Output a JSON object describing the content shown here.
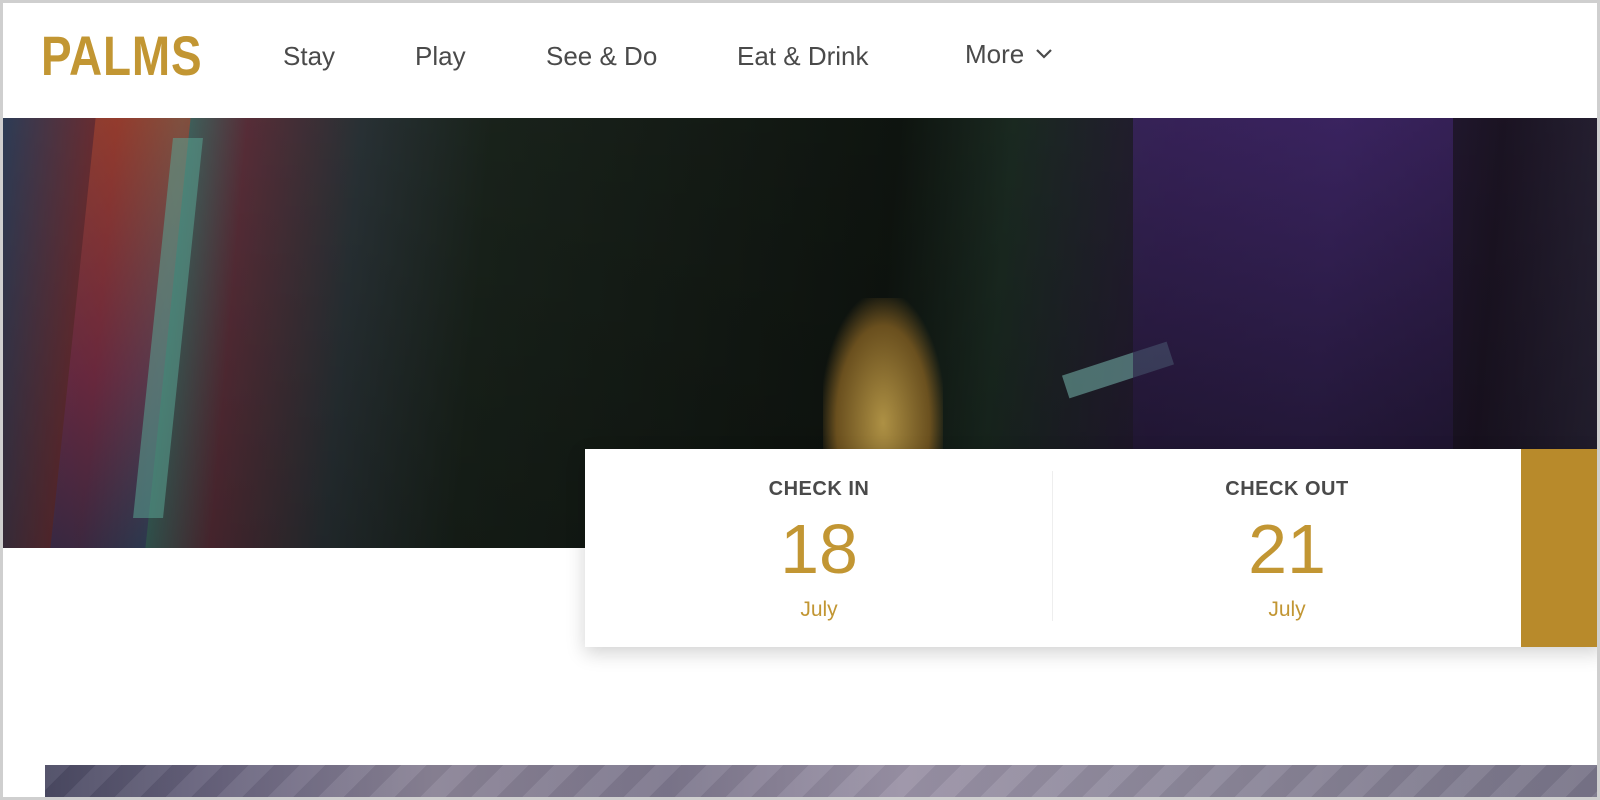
{
  "brand": {
    "logo_text": "PALMS",
    "accent_color": "#c29633",
    "button_color": "#b88a2b"
  },
  "nav": {
    "items": [
      {
        "label": "Stay"
      },
      {
        "label": "Play"
      },
      {
        "label": "See & Do"
      },
      {
        "label": "Eat & Drink"
      }
    ],
    "more": {
      "label": "More",
      "icon": "chevron-down-icon"
    }
  },
  "booking": {
    "check_in": {
      "label": "CHECK IN",
      "day": "18",
      "month": "July"
    },
    "check_out": {
      "label": "CHECK OUT",
      "day": "21",
      "month": "July"
    }
  }
}
